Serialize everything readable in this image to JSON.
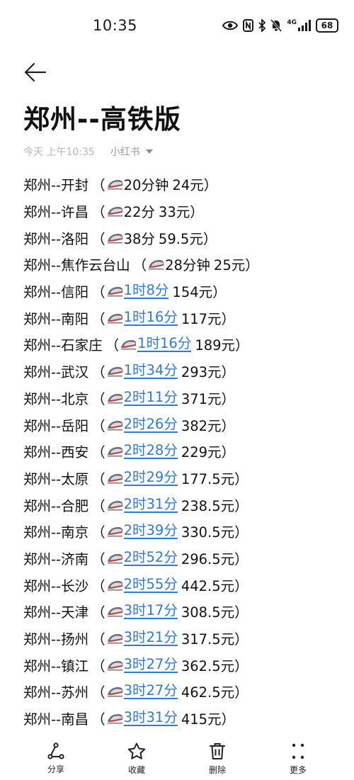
{
  "status_bar": {
    "time": "10:35",
    "network": "4G",
    "battery": "68",
    "icons": [
      "eye-icon",
      "nfc-icon",
      "bluetooth-icon",
      "mute-icon",
      "signal-icon",
      "battery-icon"
    ]
  },
  "header": {
    "back_icon": "back-arrow-icon",
    "title": "郑州--高铁版"
  },
  "meta": {
    "date": "今天 上午10:35",
    "source": "小红书"
  },
  "routes": [
    {
      "name": "郑州--开封",
      "open": "（",
      "duration": "20分钟",
      "link": false,
      "price": "24元）"
    },
    {
      "name": "郑州--许昌",
      "open": "（",
      "duration": "22分",
      "link": false,
      "price": "33元）"
    },
    {
      "name": "郑州--洛阳",
      "open": "（",
      "duration": "38分",
      "link": false,
      "price": "59.5元）"
    },
    {
      "name": "郑州--焦作云台山",
      "open": "（",
      "duration": "28分钟",
      "link": false,
      "price": "25元）"
    },
    {
      "name": "郑州--信阳",
      "open": "（",
      "duration": "1时8分",
      "link": true,
      "price": "154元）"
    },
    {
      "name": "郑州--南阳",
      "open": "（",
      "duration": "1时16分",
      "link": true,
      "price": "117元）"
    },
    {
      "name": "郑州--石家庄",
      "open": "（",
      "duration": "1时16分",
      "link": true,
      "price": "189元）"
    },
    {
      "name": "郑州--武汉",
      "open": "（",
      "duration": "1时34分",
      "link": true,
      "price": "293元）"
    },
    {
      "name": "郑州--北京",
      "open": "（",
      "duration": "2时11分",
      "link": true,
      "price": "371元）"
    },
    {
      "name": "郑州--岳阳",
      "open": "（",
      "duration": "2时26分",
      "link": true,
      "price": "382元）"
    },
    {
      "name": "郑州--西安",
      "open": "（",
      "duration": "2时28分",
      "link": true,
      "price": "229元）"
    },
    {
      "name": "郑州--太原",
      "open": "（",
      "duration": "2时29分",
      "link": true,
      "price": "177.5元）"
    },
    {
      "name": "郑州--合肥",
      "open": "（",
      "duration": "2时31分",
      "link": true,
      "price": "238.5元）"
    },
    {
      "name": "郑州--南京",
      "open": "（",
      "duration": "2时39分",
      "link": true,
      "price": "330.5元）"
    },
    {
      "name": "郑州--济南",
      "open": "（",
      "duration": "2时52分",
      "link": true,
      "price": "296.5元）"
    },
    {
      "name": "郑州--长沙",
      "open": "（",
      "duration": "2时55分",
      "link": true,
      "price": "442.5元）"
    },
    {
      "name": "郑州--天津",
      "open": "（",
      "duration": "3时17分",
      "link": true,
      "price": "308.5元）"
    },
    {
      "name": "郑州--扬州",
      "open": "（",
      "duration": "3时21分",
      "link": true,
      "price": "317.5元）"
    },
    {
      "name": "郑州--镇江",
      "open": "（",
      "duration": "3时27分",
      "link": true,
      "price": "362.5元）"
    },
    {
      "name": "郑州--苏州",
      "open": "（",
      "duration": "3时27分",
      "link": true,
      "price": "462.5元）"
    },
    {
      "name": "郑州--南昌",
      "open": "（",
      "duration": "3时31分",
      "link": true,
      "price": "415元）"
    }
  ],
  "bottom_bar": {
    "share": "分享",
    "favorite": "收藏",
    "delete": "删除",
    "more": "更多"
  },
  "colors": {
    "link": "#2f7ad9",
    "meta_text": "#b5b5b5",
    "title_text": "#111111"
  }
}
